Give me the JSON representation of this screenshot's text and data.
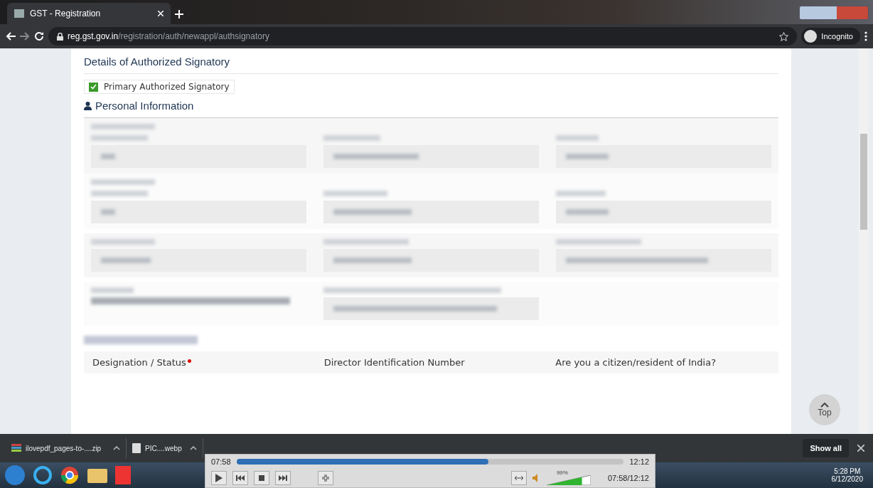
{
  "browser": {
    "tab": {
      "title": "GST - Registration"
    },
    "url": {
      "domain": "reg.gst.gov.in",
      "path": "/registration/auth/newappl/authsignatory"
    },
    "profile": "Incognito"
  },
  "page": {
    "section_title": "Details of Authorized Signatory",
    "primary_checkbox": {
      "label": "Primary Authorized Signatory",
      "checked": true
    },
    "subsection_title": "Personal Information",
    "table_headers": [
      {
        "label": "Designation / Status",
        "required": true
      },
      {
        "label": "Director Identification Number",
        "required": false
      },
      {
        "label": "Are you a citizen/resident of India?",
        "required": false
      }
    ],
    "top_button": "Top"
  },
  "downloads": {
    "items": [
      {
        "name": "ilovepdf_pages-to-....zip",
        "kind": "archive"
      },
      {
        "name": "PIC....webp",
        "kind": "file"
      }
    ],
    "show_all": "Show all"
  },
  "media_player": {
    "elapsed": "07:58",
    "total": "12:12",
    "progress": {
      "level": 0.65
    },
    "volume": {
      "level": 0.8
    },
    "volume_reading": "99%",
    "time_display": "07:58/12:12"
  },
  "taskbar": {
    "time": "5:28 PM",
    "date": "6/12/2020"
  }
}
